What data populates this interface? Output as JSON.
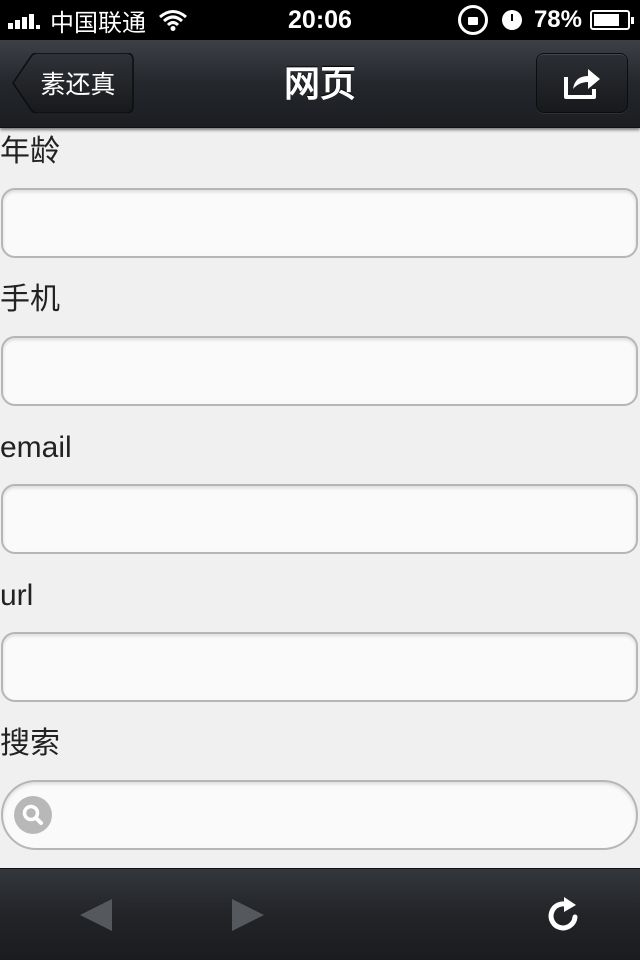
{
  "status_bar": {
    "carrier": "中国联通",
    "time": "20:06",
    "battery_percent_text": "78%",
    "battery_level": 0.78,
    "icons": [
      "signal-icon",
      "wifi-icon",
      "rotation-lock-icon",
      "alarm-icon",
      "battery-icon"
    ]
  },
  "nav": {
    "back_label": "素还真",
    "title": "网页",
    "share_icon": "share-icon"
  },
  "form": {
    "fields": [
      {
        "label": "年龄",
        "type": "number",
        "value": "",
        "placeholder": ""
      },
      {
        "label": "手机",
        "type": "tel",
        "value": "",
        "placeholder": ""
      },
      {
        "label": "email",
        "type": "email",
        "value": "",
        "placeholder": ""
      },
      {
        "label": "url",
        "type": "url",
        "value": "",
        "placeholder": ""
      },
      {
        "label": "搜索",
        "type": "search",
        "value": "",
        "placeholder": ""
      }
    ]
  },
  "toolbar": {
    "back_icon": "arrow-left-icon",
    "forward_icon": "arrow-right-icon",
    "reload_icon": "reload-icon"
  },
  "colors": {
    "background": "#f0f0f0",
    "bar_dark": "#24272c",
    "input_border": "#b6b6b6"
  }
}
